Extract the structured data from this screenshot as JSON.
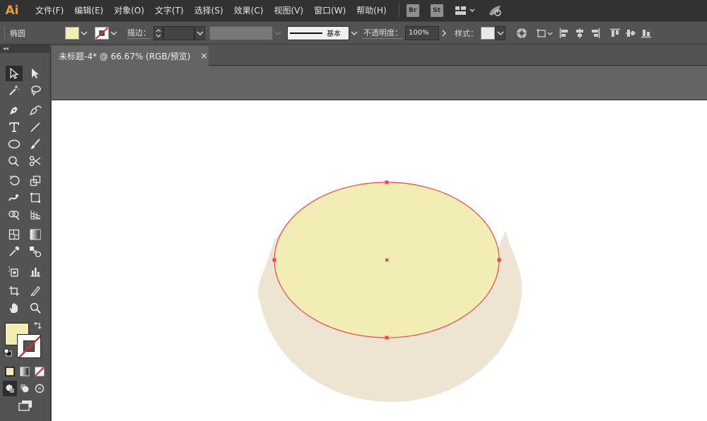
{
  "app": {
    "logo": "Ai"
  },
  "menu": [
    "文件(F)",
    "编辑(E)",
    "对象(O)",
    "文字(T)",
    "选择(S)",
    "效果(C)",
    "视图(V)",
    "窗口(W)",
    "帮助(H)"
  ],
  "menu_badges": {
    "bridge": "Br",
    "stock": "St"
  },
  "control": {
    "selection_label": "椭圆",
    "stroke_label": "描边：",
    "stroke_weight": "",
    "brush_profile": "基本",
    "opacity_label": "不透明度：",
    "opacity_value": "100%",
    "style_label": "样式："
  },
  "toolbar": {
    "collapse": "◂◂"
  },
  "document": {
    "tab_title": "未标题-4* @ 66.67% (RGB/预览)",
    "close_glyph": "×"
  },
  "colors": {
    "fill": "#f2ecb5",
    "shadow": "#ede4d2",
    "selection": "#f2434a",
    "accent": "#ef9a38"
  },
  "icons": {
    "selection": "selection-tool-icon",
    "direct_selection": "direct-selection-tool-icon",
    "pen": "pen-tool-icon",
    "type": "type-tool-icon",
    "ellipse": "ellipse-tool-icon",
    "zoom": "zoom-tool-icon",
    "hand": "hand-tool-icon"
  }
}
